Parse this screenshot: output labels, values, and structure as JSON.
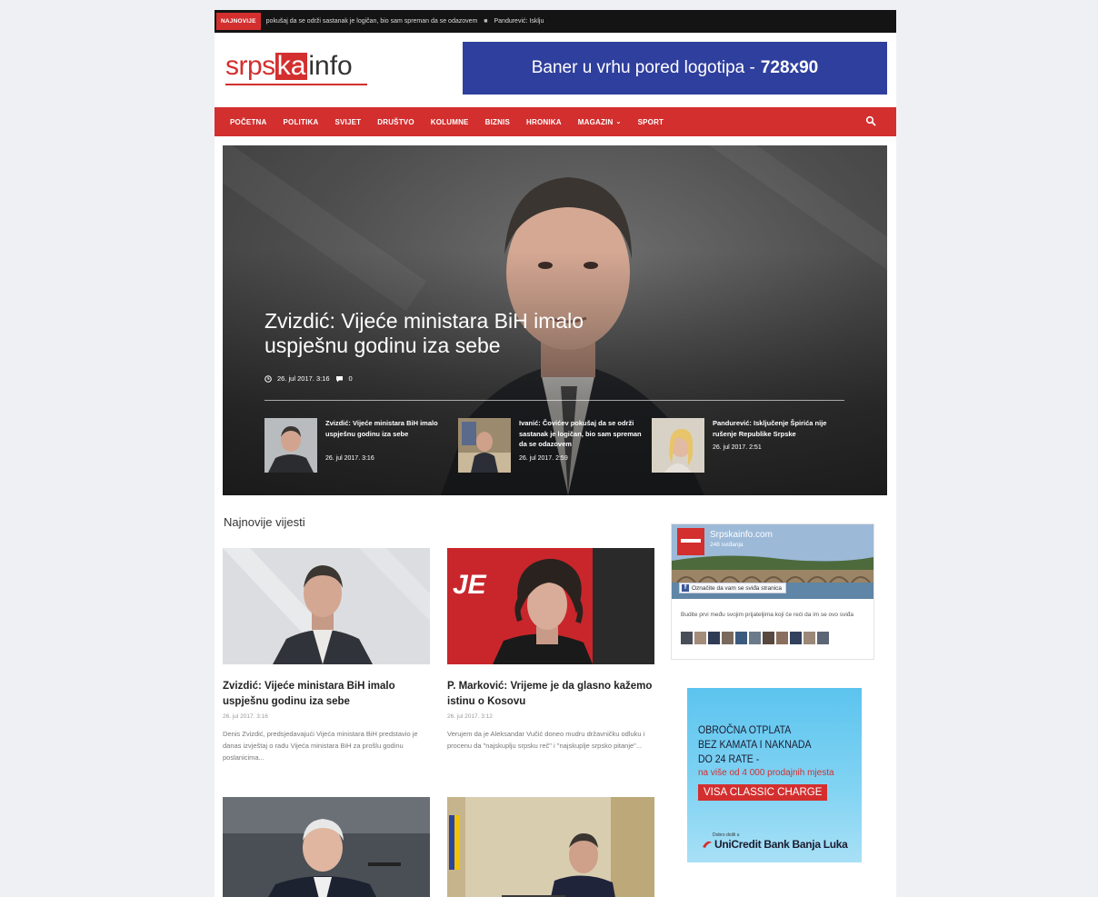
{
  "ticker": {
    "badge": "NAJNOVIJE",
    "item1": "pokušaj da se održi sastanak je logičan, bio sam spreman da se odazovem",
    "separator": "■",
    "item2": "Pandurević: Isklju"
  },
  "header": {
    "logo_srpska": "srps",
    "logo_ka": "ka",
    "logo_info": "info",
    "banner_text": "Baner u vrhu pored logotipa -",
    "banner_size": "728x90"
  },
  "nav": {
    "items": [
      "POČETNA",
      "POLITIKA",
      "SVIJET",
      "DRUŠTVO",
      "KOLUMNE",
      "BIZNIS",
      "HRONIKA",
      "MAGAZIN",
      "SPORT"
    ],
    "chevron": "⌄"
  },
  "hero": {
    "title": "Zvizdić: Vijeće ministara BiH imalo uspješnu godinu iza sebe",
    "date": "26. jul 2017. 3:16",
    "comments": "0",
    "mini": [
      {
        "title": "Zvizdić: Vijeće ministara BiH imalo uspješnu godinu iza sebe",
        "date": "26. jul 2017. 3:16"
      },
      {
        "title": "Ivanić: Čovićev pokušaj da se održi sastanak je logičan, bio sam spreman da se odazovem",
        "date": "26. jul 2017. 2:59"
      },
      {
        "title": "Pandurević: Isključenje Špirića nije rušenje Republike Srpske",
        "date": "26. jul 2017. 2:51"
      }
    ]
  },
  "main": {
    "section_title": "Najnovije vijesti",
    "cards": [
      {
        "title": "Zvizdić: Vijeće ministara BiH imalo uspješnu godinu iza sebe",
        "date": "26. jul 2017. 3:16",
        "excerpt": "Denis Zvizdić, predsjedavajući Vijeća ministara BiH predstavio je danas izvještaj o radu Vijeća ministara BiH za prošlu godinu poslanicima..."
      },
      {
        "title": "P. Marković: Vrijeme je da glasno kažemo istinu o Kosovu",
        "date": "26. jul 2017. 3:12",
        "excerpt": "Verujem da je Aleksandar Vučić doneo mudru državničku odluku i procenu da \"najskuplju srpsku reč\" i \"najskuplje srpsko pitanje\"...",
        "img_text": "JE"
      }
    ]
  },
  "sidebar": {
    "fb": {
      "page_name": "Srpskainfo.com",
      "likes": "248 sviđanja",
      "like_button": "Označite da vam se sviđa stranica",
      "friends_text": "Budite prvi među svojim prijateljima koji će reći da im se ovo sviđa"
    },
    "ad": {
      "line1": "OBROČNA OTPLATA",
      "line2": "BEZ KAMATA I NAKNADA",
      "line3": "DO 24 RATE -",
      "line4": "na više od 4 000 prodajnih mjesta",
      "cta": "VISA CLASSIC CHARGE",
      "welcome": "Dobro došli u",
      "bank": "UniCredit Bank Banja Luka"
    }
  },
  "colors": {
    "brand_red": "#d32f2f",
    "banner_blue": "#2f3f9e",
    "ad_blue": "#5cc4ef"
  }
}
